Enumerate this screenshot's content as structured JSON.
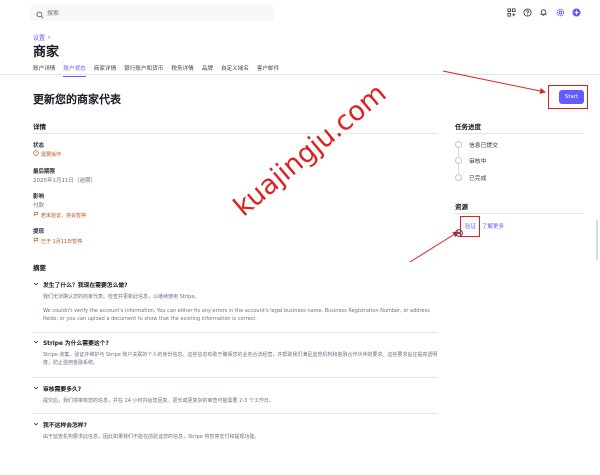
{
  "search": {
    "placeholder": "搜索"
  },
  "breadcrumb": {
    "label": "设置",
    "sep": "›"
  },
  "page": {
    "title": "商家"
  },
  "tabs": [
    {
      "label": "账户详情"
    },
    {
      "label": "账户状态"
    },
    {
      "label": "商家详情"
    },
    {
      "label": "银行账户和货币"
    },
    {
      "label": "税务详情"
    },
    {
      "label": "品牌"
    },
    {
      "label": "自定义域名"
    },
    {
      "label": "客户邮件"
    }
  ],
  "main": {
    "heading": "更新您的商家代表",
    "start_label": "Start",
    "details": {
      "title": "详情",
      "status_label": "状态",
      "status_value": "需要操作",
      "deadline_label": "最后期限",
      "deadline_value": "2025年1月11日（逾期）",
      "impact_label": "影响",
      "impact_value": "付款",
      "impact_warning": "若未验证，将会暂停",
      "payout_label": "提现",
      "payout_warning": "已于 1月11日暂停"
    },
    "summary": {
      "title": "摘要",
      "items": [
        {
          "q": "发生了什么？我现在需要怎么做?",
          "a1": "我们无法确认您的商家代表。检查并更新此信息，以继续使用 Stripe。",
          "a2": "We couldn't verify the account's information. You can either fix any errors in the account's legal business name, Business Registration Number, or address fields; or you can upload a document to show that the existing information is correct."
        },
        {
          "q": "Stripe 为什么需要这个?",
          "a1": "Stripe 收集、验证并维护与 Stripe 账户关联的个人的身份信息。这些信息有助于确保您的业务合法经营，并帮助我们满足监管机构和金融合作伙伴的要求。这些要求旨在提高透明度，防止滥用金融系统。"
        },
        {
          "q": "审核需要多久?",
          "a1": "提交后，我们将审核您的信息，并在 24 小时内给您回复。更长或更复杂的审查可能需要 2-3 个工作日。"
        },
        {
          "q": "我不这样会怎样?",
          "a1": "由于监管机构要求此信息，因此如果我们不能在前验证您的信息，Stripe 将暂停支付和提现功能。"
        }
      ]
    }
  },
  "side": {
    "progress_title": "任务进度",
    "steps": [
      {
        "label": "信息已提交"
      },
      {
        "label": "审核中"
      },
      {
        "label": "已完成"
      }
    ],
    "resources_title": "资源",
    "res_link1": "验证",
    "res_link2": "了解更多"
  },
  "watermark": {
    "text": "kuajingju.com"
  },
  "colors": {
    "accent": "#635bff",
    "warning": "#b3531e",
    "annotation": "#e02020"
  }
}
